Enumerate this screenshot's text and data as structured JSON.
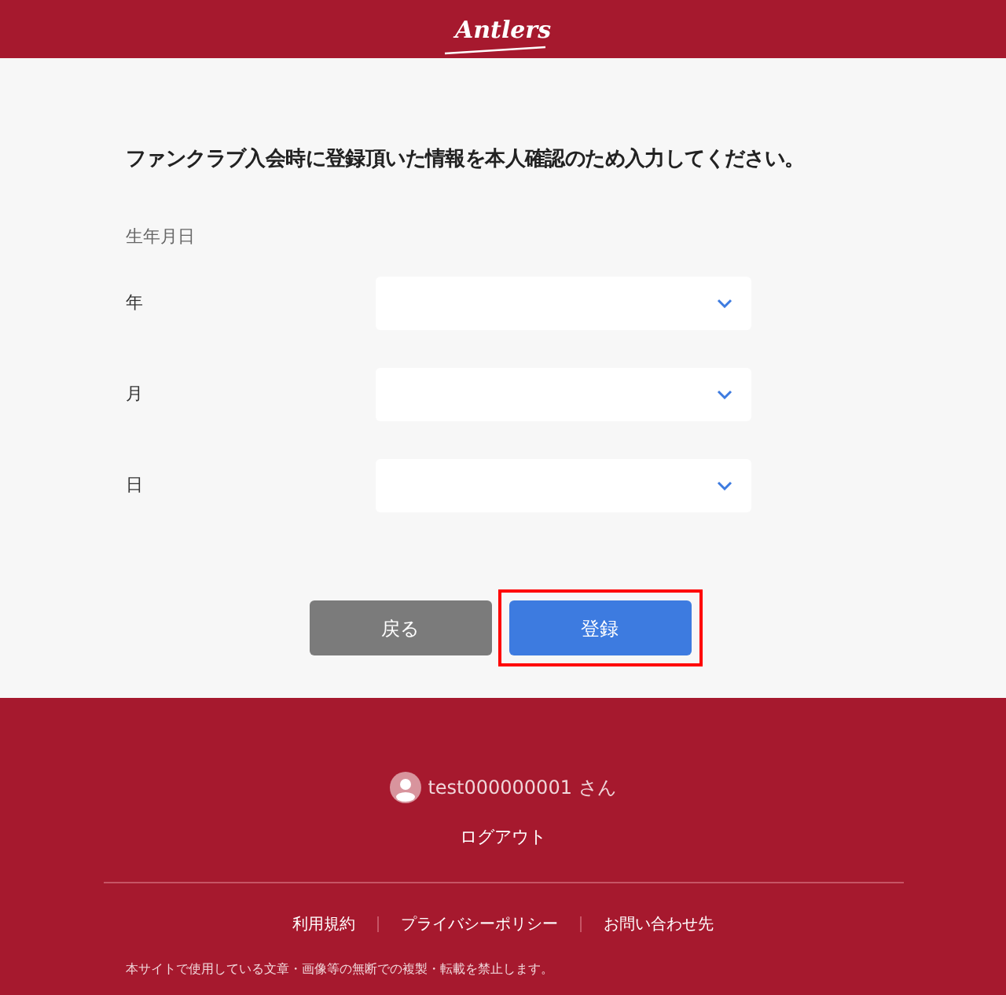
{
  "header": {
    "logo": "Antlers"
  },
  "form": {
    "instruction": "ファンクラブ入会時に登録頂いた情報を本人確認のため入力してください。",
    "section_label": "生年月日",
    "fields": [
      {
        "label": "年"
      },
      {
        "label": "月"
      },
      {
        "label": "日"
      }
    ]
  },
  "buttons": [
    {
      "label": "戻る",
      "kind": "secondary",
      "highlighted": false
    },
    {
      "label": "登録",
      "kind": "primary",
      "highlighted": true
    }
  ],
  "footer": {
    "user": "test000000001 さん",
    "logout": "ログアウト",
    "links": [
      "利用規約",
      "プライバシーポリシー",
      "お問い合わせ先"
    ],
    "notice": "本サイトで使用している文章・画像等の無断での複製・転載を禁止します。"
  }
}
